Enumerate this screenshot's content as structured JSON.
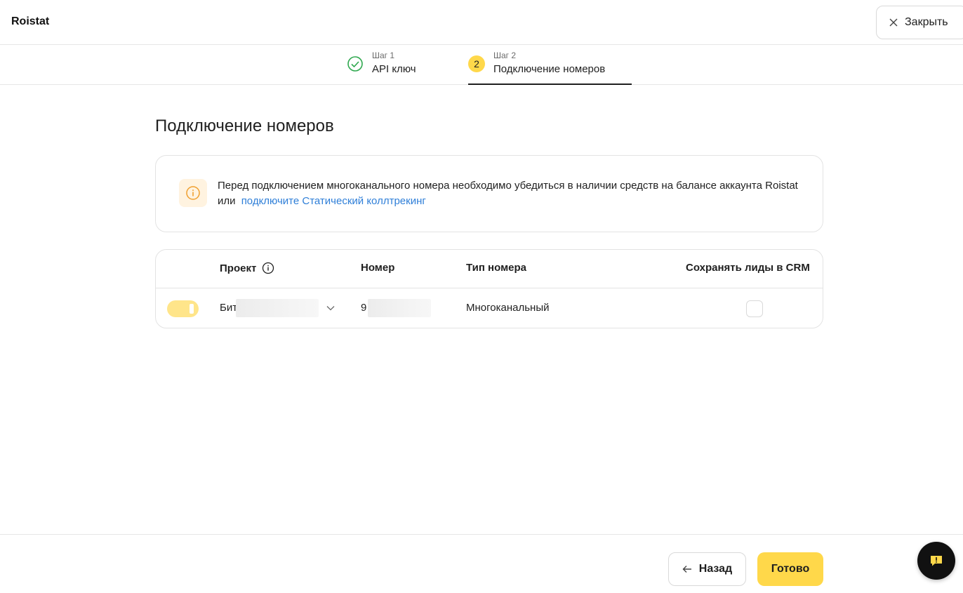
{
  "header": {
    "brand": "Roistat",
    "close_label": "Закрыть"
  },
  "steps": [
    {
      "small": "Шаг 1",
      "label": "API ключ",
      "state": "done"
    },
    {
      "small": "Шаг 2",
      "number": "2",
      "label": "Подключение номеров",
      "state": "active"
    }
  ],
  "main": {
    "title": "Подключение номеров",
    "notice": {
      "text": "Перед подключением многоканального номера необходимо убедиться в наличии средств на балансе аккаунта Roistat или",
      "link": "подключите Статический коллтрекинг"
    },
    "table": {
      "columns": [
        "Проект",
        "Номер",
        "Тип номера",
        "Сохранять лиды в CRM"
      ],
      "rows": [
        {
          "enabled": true,
          "project": "Бит",
          "number": "9",
          "type": "Многоканальный",
          "save_leads": false
        }
      ]
    }
  },
  "footer": {
    "back_label": "Назад",
    "done_label": "Готово"
  },
  "colors": {
    "accent": "#ffd84a",
    "link": "#2f7fd8",
    "success": "#2fa84f",
    "warning": "#f0a030"
  },
  "icons": [
    "close-icon",
    "check-circle-icon",
    "info-icon",
    "chevron-down-icon",
    "arrow-left-icon",
    "feedback-icon"
  ]
}
